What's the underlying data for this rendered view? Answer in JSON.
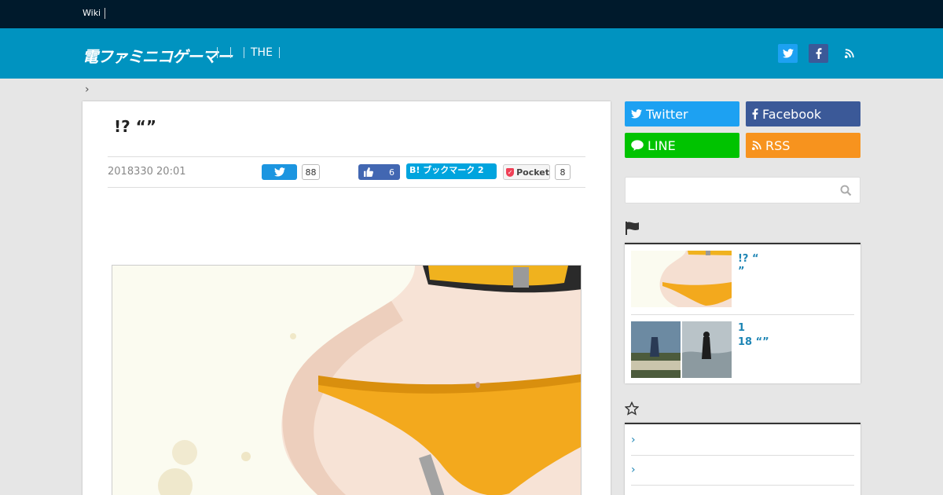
{
  "topbar": {
    "wiki_label": "Wiki"
  },
  "header": {
    "logo_text": "電ファミニコゲーマー",
    "nav": [
      "",
      "",
      "THE"
    ],
    "icons": [
      "twitter-icon",
      "facebook-icon",
      "rss-icon"
    ]
  },
  "breadcrumb": {
    "arrow": "›"
  },
  "article": {
    "title": "!? “”",
    "date": "2018330 20:01",
    "tweet_count": "88",
    "like_count": "6",
    "hatena_label": "B! ブックマーク 2",
    "pocket_label": "Pocket",
    "pocket_count": "8"
  },
  "sidebar": {
    "follow": [
      {
        "label": "Twitter",
        "color": "#1da1f2",
        "icon": "twitter-icon"
      },
      {
        "label": "Facebook",
        "color": "#3b5998",
        "icon": "facebook-icon"
      },
      {
        "label": "LINE",
        "color": "#00c300",
        "icon": "line-icon"
      },
      {
        "label": "RSS",
        "color": "#f7931e",
        "icon": "rss-icon"
      }
    ],
    "search_placeholder": "",
    "ranking_icon": "flag-icon",
    "ranking": [
      {
        "line1": "!? “",
        "line2": "”"
      },
      {
        "line1": "1",
        "line2": "18 “”"
      }
    ],
    "recommend_icon": "star-icon",
    "recommend": [
      {
        "arrow": "›"
      },
      {
        "arrow": "›"
      }
    ]
  },
  "colors": {
    "header": "#0093c0",
    "topbar": "#001a2c",
    "link": "#1f86b5"
  }
}
